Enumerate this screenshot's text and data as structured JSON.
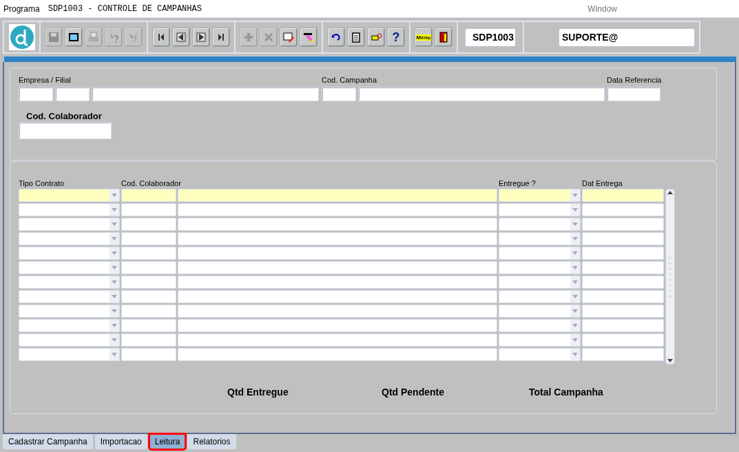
{
  "window": {
    "menu": "Programa",
    "title": "SDP1003 - CONTROLE DE CAMPANHAS",
    "window_menu": "Window"
  },
  "toolbar": {
    "groups": [
      [
        {
          "kind": "save",
          "disabled": true
        },
        {
          "kind": "screen",
          "disabled": false
        },
        {
          "kind": "print",
          "disabled": true
        },
        {
          "kind": "query",
          "disabled": true
        },
        {
          "kind": "execute",
          "disabled": true
        }
      ],
      [
        {
          "kind": "first",
          "disabled": false
        },
        {
          "kind": "prev",
          "disabled": false
        },
        {
          "kind": "next",
          "disabled": false
        },
        {
          "kind": "last",
          "disabled": false
        }
      ],
      [
        {
          "kind": "insert",
          "disabled": true
        },
        {
          "kind": "delete",
          "disabled": true
        },
        {
          "kind": "edit",
          "disabled": false
        },
        {
          "kind": "erase",
          "disabled": false
        }
      ],
      [
        {
          "kind": "undo",
          "disabled": false
        },
        {
          "kind": "clipboard",
          "disabled": false
        },
        {
          "kind": "pointer",
          "disabled": false
        },
        {
          "kind": "help",
          "label": "?",
          "disabled": false
        }
      ],
      [
        {
          "kind": "menu",
          "label": "Menu",
          "disabled": false
        },
        {
          "kind": "exit",
          "disabled": false
        }
      ]
    ],
    "program_code": "SDP1003",
    "user": "SUPORTE@"
  },
  "header": {
    "fields": [
      {
        "label": "Empresa / Filial"
      },
      {
        "label": "Cod. Campanha"
      },
      {
        "label": "Data Referencia"
      }
    ],
    "collaborator_label": "Cod. Colaborador"
  },
  "grid": {
    "columns": [
      {
        "label": "Tipo Contrato",
        "kind": "combo"
      },
      {
        "label": "Cod. Colaborador",
        "kind": "text"
      },
      {
        "kind": "text"
      },
      {
        "label": "Entregue ?",
        "kind": "combo"
      },
      {
        "label": "Dat Entrega",
        "kind": "text"
      }
    ],
    "rows": [
      {
        "current": true
      },
      {
        "current": false
      },
      {
        "current": false
      },
      {
        "current": false
      },
      {
        "current": false
      },
      {
        "current": false
      },
      {
        "current": false
      },
      {
        "current": false
      },
      {
        "current": false
      },
      {
        "current": false
      },
      {
        "current": false
      },
      {
        "current": false
      }
    ]
  },
  "totals": [
    {
      "label": "Qtd Entregue"
    },
    {
      "label": "Qtd Pendente"
    },
    {
      "label": "Total Campanha"
    }
  ],
  "tabs": [
    {
      "label": "Cadastrar Campanha",
      "selected": false,
      "highlighted": false
    },
    {
      "label": "Importacao",
      "selected": false,
      "highlighted": false
    },
    {
      "label": "Leitura",
      "selected": true,
      "highlighted": true
    },
    {
      "label": "Relatorios",
      "selected": false,
      "highlighted": false
    }
  ]
}
